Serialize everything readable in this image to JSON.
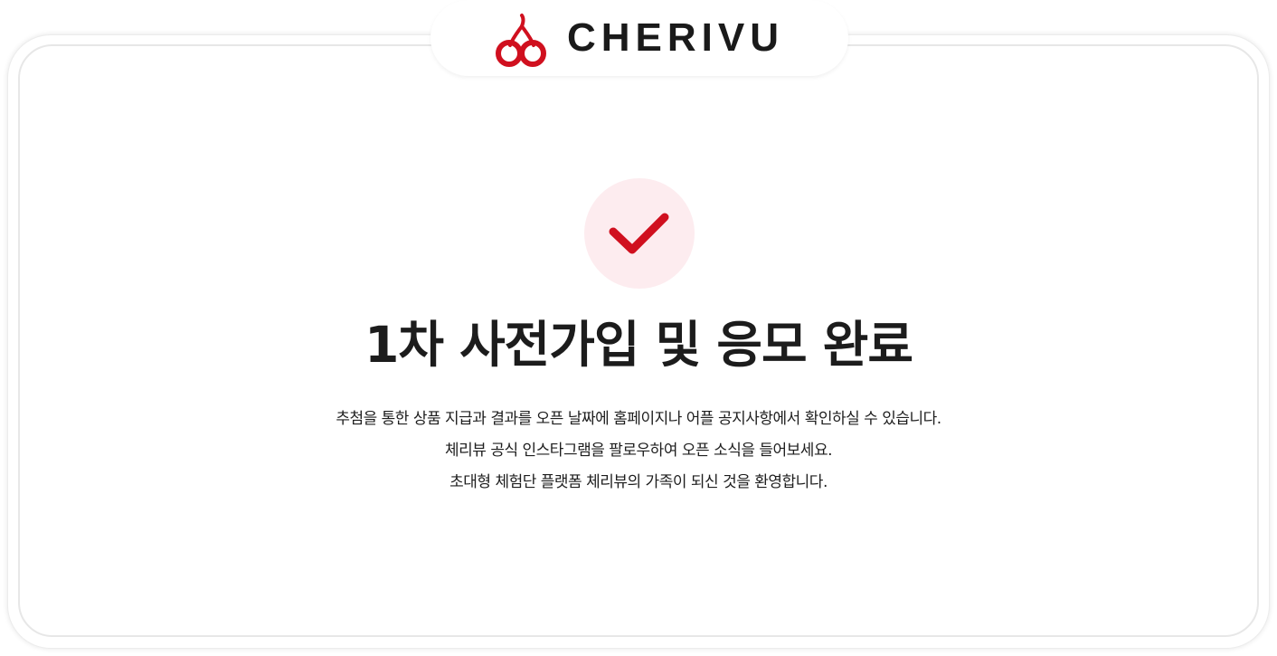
{
  "brand": {
    "name": "CHERIVU",
    "logo_icon": "cherry-icon",
    "accent_color": "#d0101f"
  },
  "status": {
    "icon": "checkmark-icon",
    "badge_color": "#fdecef",
    "check_color": "#d0101f"
  },
  "title": "1차 사전가입 및 응모 완료",
  "messages": [
    "추첨을 통한 상품 지급과 결과를 오픈 날짜에 홈페이지나 어플 공지사항에서 확인하실 수 있습니다.",
    "체리뷰 공식 인스타그램을 팔로우하여 오픈 소식을 들어보세요.",
    "초대형 체험단 플랫폼 체리뷰의 가족이 되신 것을 환영합니다."
  ]
}
